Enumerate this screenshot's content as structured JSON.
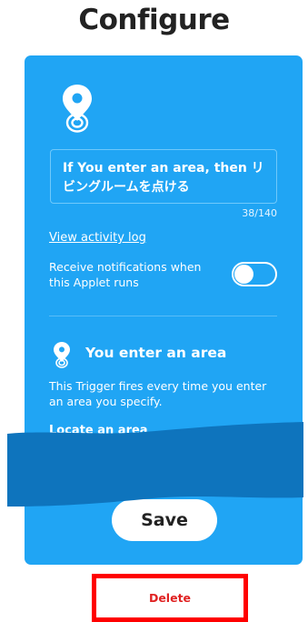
{
  "header": {
    "title": "Configure"
  },
  "applet": {
    "icon": "location-pin-icon",
    "title_value": "If You enter an area, then リビングルームを点ける",
    "char_count": "38/140",
    "activity_link": "View activity log",
    "notification_label": "Receive notifications when this Applet runs",
    "notifications_enabled": false
  },
  "trigger": {
    "icon": "location-pin-icon",
    "title": "You enter an area",
    "description": "This Trigger fires every time you enter an area you specify.",
    "locate_label": "Locate an area"
  },
  "actions": {
    "save_label": "Save",
    "delete_label": "Delete"
  },
  "colors": {
    "card_background": "#20a5f4",
    "redaction": "#0e74bd",
    "highlight_border": "#ff0000",
    "delete_text": "#e02121"
  }
}
